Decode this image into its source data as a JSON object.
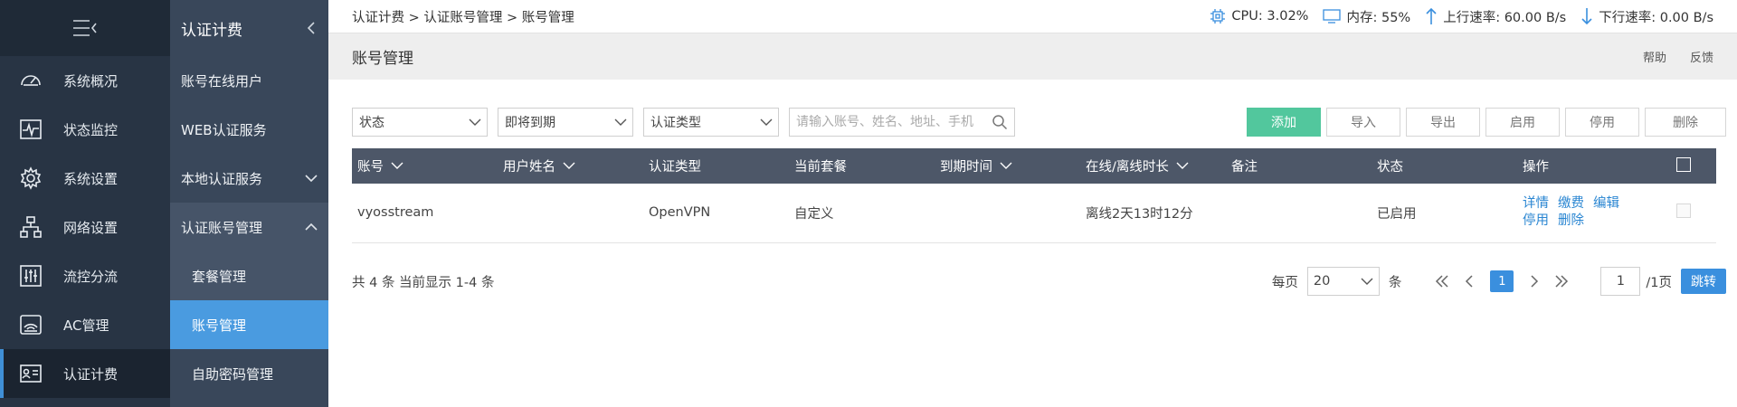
{
  "nav1": {
    "items": [
      {
        "label": "系统概况"
      },
      {
        "label": "状态监控"
      },
      {
        "label": "系统设置"
      },
      {
        "label": "网络设置"
      },
      {
        "label": "流控分流"
      },
      {
        "label": "AC管理"
      },
      {
        "label": "认证计费"
      }
    ]
  },
  "nav2": {
    "title": "认证计费",
    "items": [
      {
        "label": "账号在线用户"
      },
      {
        "label": "WEB认证服务"
      },
      {
        "label": "本地认证服务"
      },
      {
        "label": "认证账号管理"
      },
      {
        "label": "套餐管理"
      },
      {
        "label": "账号管理"
      },
      {
        "label": "自助密码管理"
      }
    ]
  },
  "topbar": {
    "breadcrumb": "认证计费 > 认证账号管理 > 账号管理",
    "cpu": "CPU: 3.02%",
    "mem": "内存: 55%",
    "up": "上行速率: 60.00 B/s",
    "down": "下行速率: 0.00 B/s"
  },
  "titlebar": {
    "title": "账号管理",
    "help": "帮助",
    "feedback": "反馈"
  },
  "filters": {
    "status": "状态",
    "expire": "即将到期",
    "auth_type": "认证类型",
    "search_placeholder": "请输入账号、姓名、地址、手机"
  },
  "buttons": {
    "add": "添加",
    "import": "导入",
    "export": "导出",
    "enable": "启用",
    "disable": "停用",
    "delete": "删除"
  },
  "table": {
    "headers": [
      "账号",
      "用户姓名",
      "认证类型",
      "当前套餐",
      "到期时间",
      "在线/离线时长",
      "备注",
      "状态",
      "操作"
    ],
    "rows": [
      {
        "account": "vyosstream",
        "name": "",
        "auth_type": "OpenVPN",
        "package": "自定义",
        "expire": "",
        "duration": "离线2天13时12分",
        "note": "",
        "status": "已启用",
        "ops": [
          "详情",
          "缴费",
          "编辑",
          "停用",
          "删除"
        ]
      }
    ]
  },
  "footer": {
    "summary": "共 4 条 当前显示 1-4 条",
    "per_page_label": "每页",
    "per_page": "20",
    "unit": "条",
    "current_page": "1",
    "page_input": "1",
    "total_pages": "/1页",
    "go": "跳转"
  },
  "colors": {
    "sidebar_dark": "#283444",
    "sidebar_second": "#39475a",
    "active_blue": "#4a9be0",
    "add_green": "#52c79d",
    "table_header": "#4d5768",
    "status_green": "#4cbe8f",
    "link_blue": "#2a86d2"
  }
}
